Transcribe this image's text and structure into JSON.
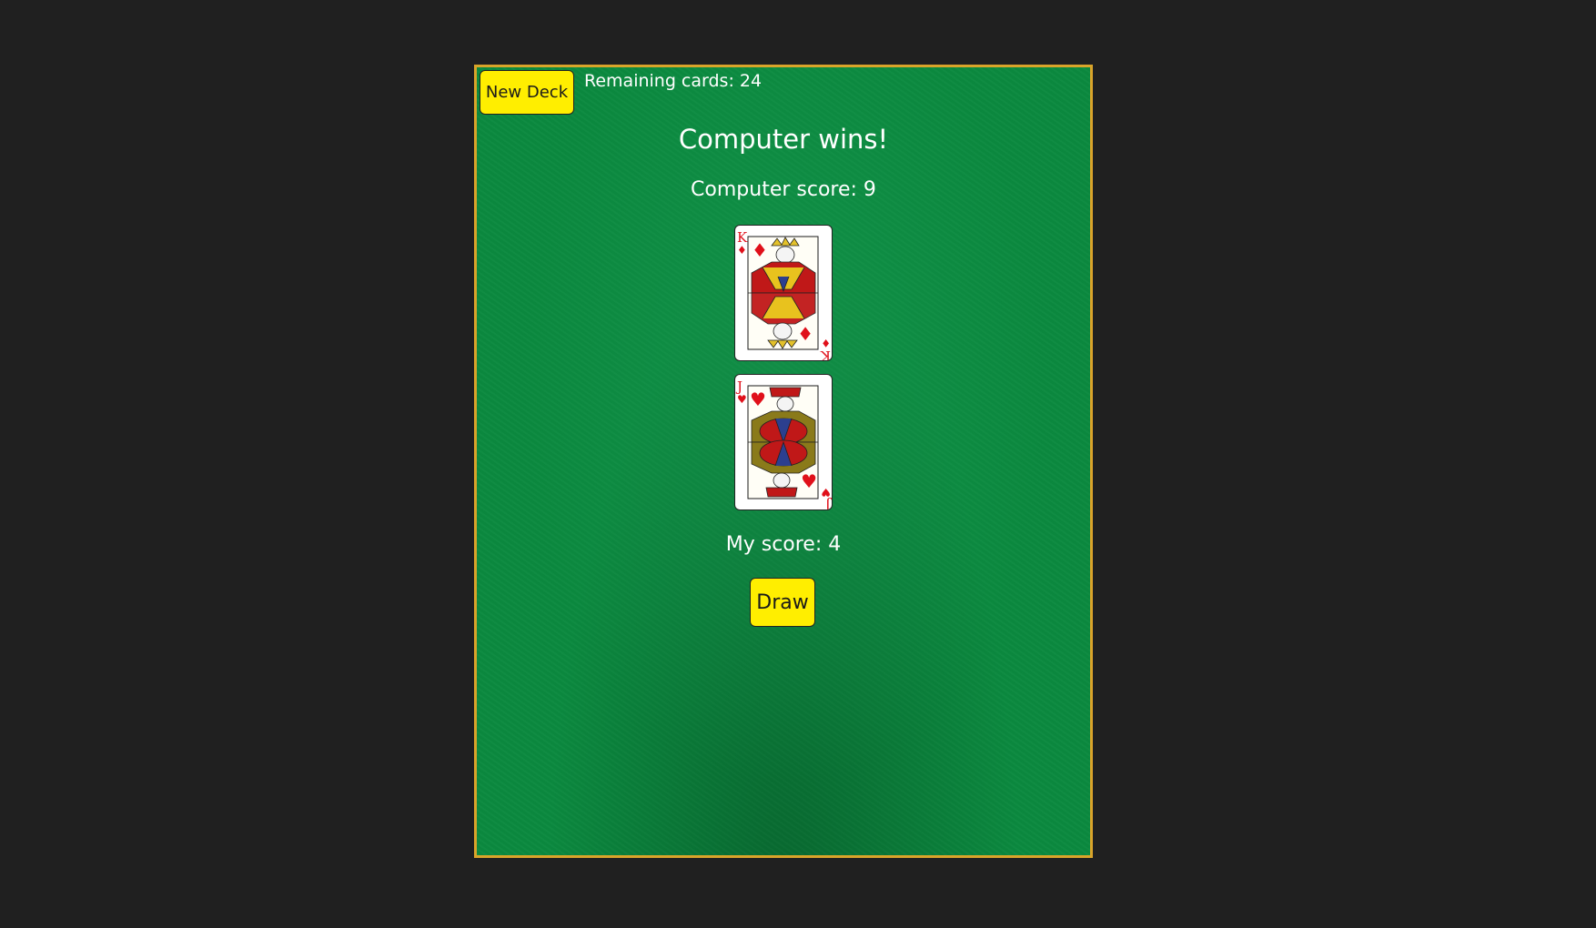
{
  "header": {
    "new_deck_label": "New Deck",
    "remaining_label": "Remaining cards: 24"
  },
  "game": {
    "result": "Computer wins!",
    "computer_score": "Computer score: 9",
    "my_score": "My score: 4",
    "draw_label": "Draw"
  },
  "cards": {
    "computer": {
      "rank": "K",
      "suit": "♦",
      "name": "king-of-diamonds"
    },
    "player": {
      "rank": "J",
      "suit": "♥",
      "name": "jack-of-hearts"
    }
  },
  "colors": {
    "felt": "#0b8a3f",
    "table_border": "#d9a42a",
    "button": "#ffee00",
    "page_background": "#202020",
    "card_red": "#e0101a"
  }
}
